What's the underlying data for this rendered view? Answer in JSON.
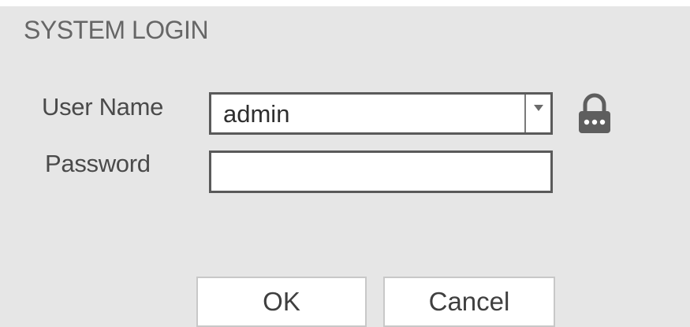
{
  "dialog": {
    "title": "SYSTEM LOGIN"
  },
  "form": {
    "username_label": "User Name",
    "username_value": "admin",
    "password_label": "Password",
    "password_value": ""
  },
  "icons": {
    "dropdown": "chevron-down-icon",
    "lock": "lock-icon"
  },
  "buttons": {
    "ok_label": "OK",
    "cancel_label": "Cancel"
  },
  "colors": {
    "dialog_bg": "#e6e6e6",
    "field_border": "#5a5a5a",
    "text": "#4a4a4a"
  }
}
